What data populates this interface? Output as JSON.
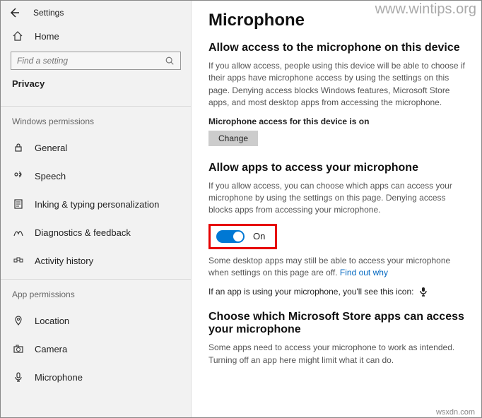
{
  "app": {
    "title": "Settings"
  },
  "watermark": "www.wintips.org",
  "footer": "wsxdn.com",
  "sidebar": {
    "home_label": "Home",
    "search_placeholder": "Find a setting",
    "current_section": "Privacy",
    "groups": [
      {
        "header": "Windows permissions",
        "items": [
          {
            "icon": "lock-icon",
            "label": "General"
          },
          {
            "icon": "speech-icon",
            "label": "Speech"
          },
          {
            "icon": "inking-icon",
            "label": "Inking & typing personalization"
          },
          {
            "icon": "diagnostics-icon",
            "label": "Diagnostics & feedback"
          },
          {
            "icon": "history-icon",
            "label": "Activity history"
          }
        ]
      },
      {
        "header": "App permissions",
        "items": [
          {
            "icon": "location-icon",
            "label": "Location"
          },
          {
            "icon": "camera-icon",
            "label": "Camera"
          },
          {
            "icon": "microphone-icon",
            "label": "Microphone"
          }
        ]
      }
    ]
  },
  "main": {
    "title": "Microphone",
    "section1": {
      "heading": "Allow access to the microphone on this device",
      "desc": "If you allow access, people using this device will be able to choose if their apps have microphone access by using the settings on this page. Denying access blocks Windows features, Microsoft Store apps, and most desktop apps from accessing the microphone.",
      "status": "Microphone access for this device is on",
      "change_label": "Change"
    },
    "section2": {
      "heading": "Allow apps to access your microphone",
      "desc": "If you allow access, you can choose which apps can access your microphone by using the settings on this page. Denying access blocks apps from accessing your microphone.",
      "toggle_state": "On",
      "note_part1": "Some desktop apps may still be able to access your microphone when settings on this page are off. ",
      "note_link": "Find out why",
      "using_note": "If an app is using your microphone, you'll see this icon:"
    },
    "section3": {
      "heading": "Choose which Microsoft Store apps can access your microphone",
      "desc": "Some apps need to access your microphone to work as intended. Turning off an app here might limit what it can do."
    }
  }
}
